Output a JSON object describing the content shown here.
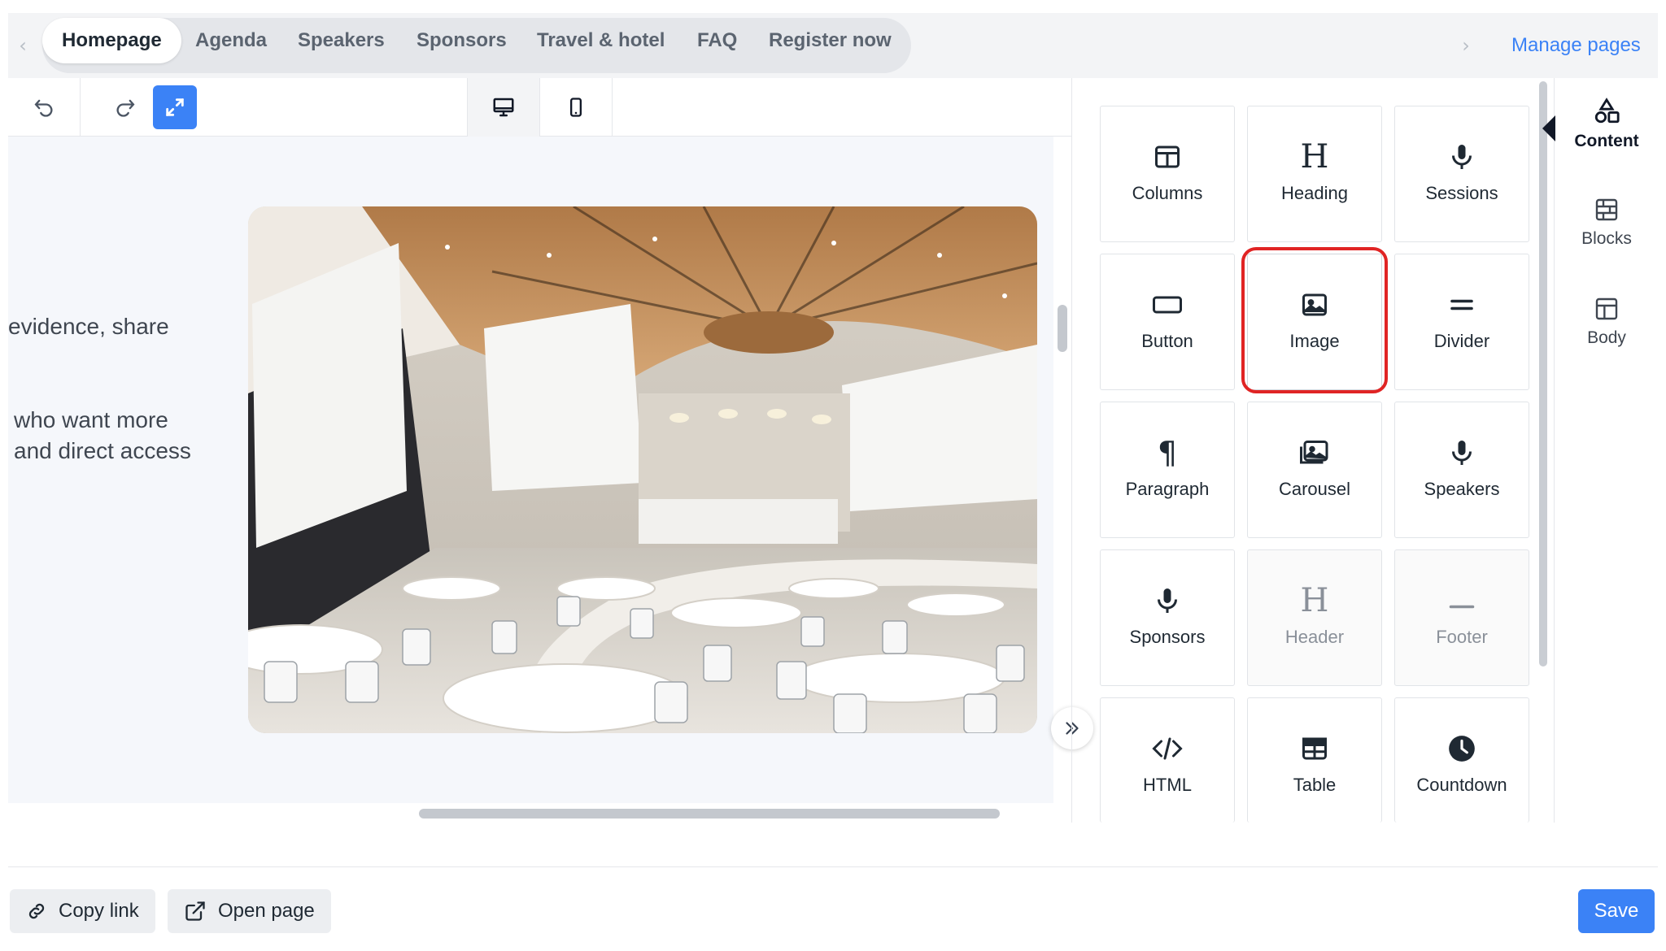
{
  "tabs": [
    {
      "label": "Homepage",
      "active": true
    },
    {
      "label": "Agenda"
    },
    {
      "label": "Speakers"
    },
    {
      "label": "Sponsors"
    },
    {
      "label": "Travel & hotel"
    },
    {
      "label": "FAQ"
    },
    {
      "label": "Register now"
    }
  ],
  "manage_pages": "Manage pages",
  "toolbar": {
    "icons": [
      "undo-icon",
      "redo-icon",
      "fullscreen-icon",
      "desktop-icon",
      "mobile-icon"
    ]
  },
  "canvas": {
    "text_lines": [
      "evidence, share",
      "who want more",
      "and direct access"
    ],
    "image": "conference-hall-photo"
  },
  "panel": {
    "tiles": [
      {
        "label": "Columns",
        "icon": "columns-icon"
      },
      {
        "label": "Heading",
        "icon": "heading-icon"
      },
      {
        "label": "Sessions",
        "icon": "microphone-icon"
      },
      {
        "label": "Button",
        "icon": "button-icon"
      },
      {
        "label": "Image",
        "icon": "image-icon",
        "highlighted": true
      },
      {
        "label": "Divider",
        "icon": "divider-icon"
      },
      {
        "label": "Paragraph",
        "icon": "paragraph-icon"
      },
      {
        "label": "Carousel",
        "icon": "carousel-icon"
      },
      {
        "label": "Speakers",
        "icon": "microphone-icon"
      },
      {
        "label": "Sponsors",
        "icon": "microphone-icon"
      },
      {
        "label": "Header",
        "icon": "heading-icon",
        "disabled": true
      },
      {
        "label": "Footer",
        "icon": "footer-icon",
        "disabled": true
      },
      {
        "label": "HTML",
        "icon": "code-icon"
      },
      {
        "label": "Table",
        "icon": "table-icon"
      },
      {
        "label": "Countdown",
        "icon": "clock-icon"
      }
    ],
    "highlight_color": "#e02424"
  },
  "sidebar": {
    "items": [
      {
        "label": "Content",
        "icon": "shapes-icon",
        "active": true
      },
      {
        "label": "Blocks",
        "icon": "blocks-icon"
      },
      {
        "label": "Body",
        "icon": "layout-icon"
      }
    ]
  },
  "footer": {
    "copy_link": "Copy link",
    "open_page": "Open page",
    "save": "Save"
  },
  "colors": {
    "accent": "#3b82f6",
    "highlight": "#e02424"
  }
}
